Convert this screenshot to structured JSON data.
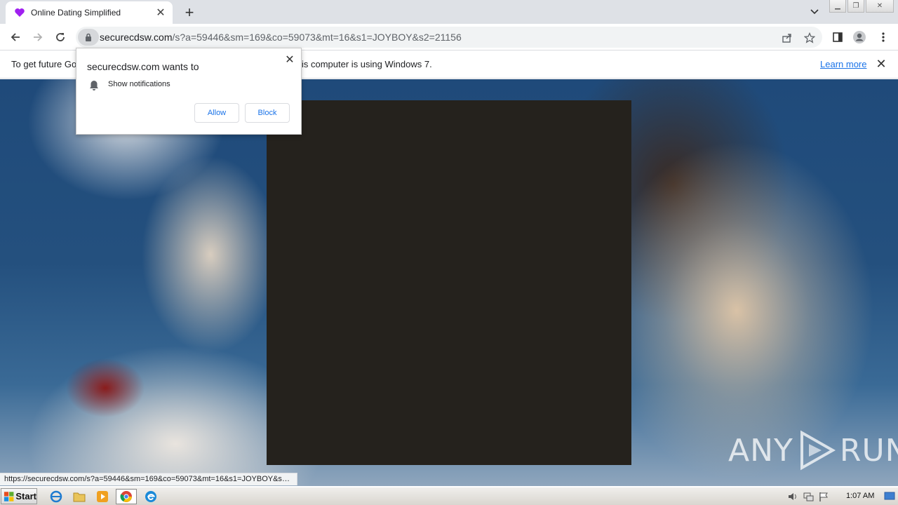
{
  "tab": {
    "title": "Online Dating Simplified",
    "favicon": "heart-icon",
    "favicon_color": "#a020f0"
  },
  "address_bar": {
    "host": "securecdsw.com",
    "path": "/s?a=59446&sm=169&co=59073&mt=16&s1=JOYBOY&s2=21156"
  },
  "infobar": {
    "text_left": "To get future Go",
    "text_right": "is computer is using Windows 7.",
    "learn_more": "Learn more"
  },
  "permission_popup": {
    "title": "securecdsw.com wants to",
    "permission": "Show notifications",
    "allow_label": "Allow",
    "block_label": "Block"
  },
  "status_bar": {
    "url": "https://securecdsw.com/s?a=59446&sm=169&co=59073&mt=16&s1=JOYBOY&s2..."
  },
  "watermark": {
    "left": "ANY",
    "right": "RUN"
  },
  "taskbar": {
    "start_label": "Start",
    "clock": "1:07 AM"
  },
  "colors": {
    "accent": "#1a73e8",
    "dark_box": "#25221d"
  }
}
